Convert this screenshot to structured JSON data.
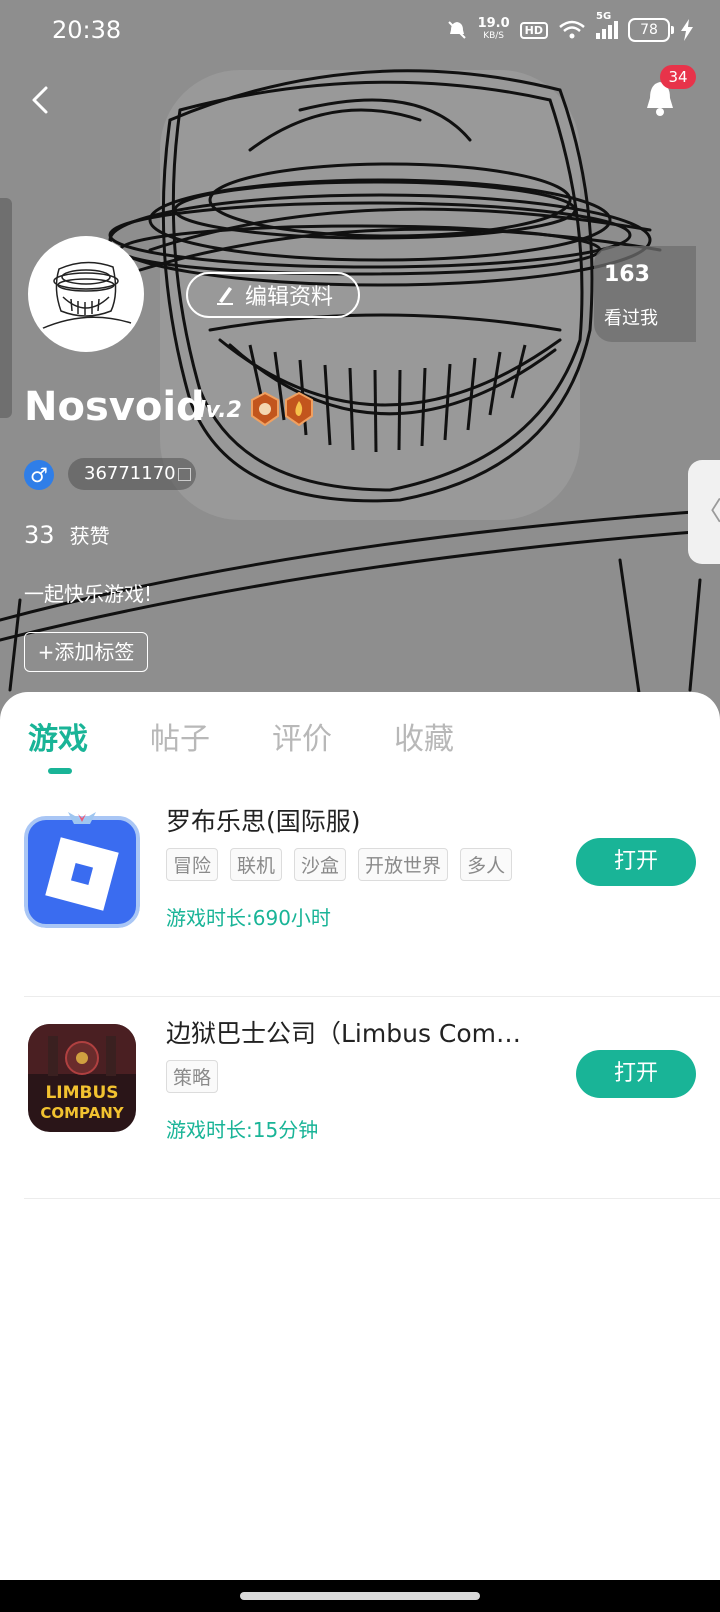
{
  "status_bar": {
    "time": "20:38",
    "speed_value": "19.0",
    "speed_unit": "KB/S",
    "hd": "HD",
    "network": "5G",
    "battery": "78"
  },
  "header": {
    "notification_count": "34"
  },
  "profile": {
    "edit_label": "编辑资料",
    "visitors_count": "163",
    "visitors_label": "看过我",
    "username": "Nosvoid",
    "level": "lv.2",
    "gender_symbol": "♂",
    "user_id": "36771170",
    "likes_count": "33",
    "likes_label": "获赞",
    "bio": "一起快乐游戏!",
    "add_tag_label": "+添加标签",
    "side_arrow": "〈"
  },
  "tabs": [
    {
      "label": "游戏",
      "active": true
    },
    {
      "label": "帖子",
      "active": false
    },
    {
      "label": "评价",
      "active": false
    },
    {
      "label": "收藏",
      "active": false
    }
  ],
  "games": [
    {
      "title": "罗布乐思(国际服)",
      "tags": [
        "冒险",
        "联机",
        "沙盒",
        "开放世界",
        "多人"
      ],
      "playtime_label": "游戏时长:",
      "playtime": "690小时",
      "button": "打开",
      "icon": "roblox-icon"
    },
    {
      "title": "边狱巴士公司（Limbus Com…",
      "tags": [
        "策略"
      ],
      "playtime_label": "游戏时长:",
      "playtime": "15分钟",
      "button": "打开",
      "icon": "limbus-company-icon",
      "icon_text_1": "LIMBUS",
      "icon_text_2": "COMPANY"
    }
  ],
  "colors": {
    "accent": "#19b497",
    "badge": "#e8334a",
    "gender": "#2f7ee8"
  }
}
